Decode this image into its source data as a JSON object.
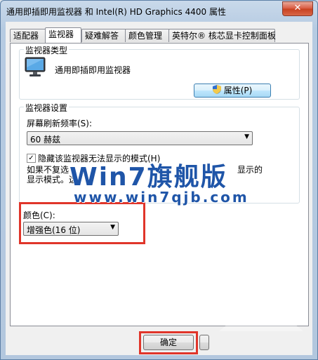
{
  "window": {
    "title": "通用即插即用监视器 和 Intel(R) HD Graphics 4400 属性",
    "close_label": "✕"
  },
  "tabs": [
    {
      "label": "适配器"
    },
    {
      "label": "监视器"
    },
    {
      "label": "疑难解答"
    },
    {
      "label": "颜色管理"
    },
    {
      "label": "英特尔® 核芯显卡控制面板"
    }
  ],
  "monitor_type": {
    "group_title": "监视器类型",
    "name": "通用即插即用监视器",
    "properties_button": "属性(P)"
  },
  "monitor_settings": {
    "group_title": "监视器设置",
    "refresh_label": "屏幕刷新频率(S):",
    "refresh_value": "60 赫兹",
    "hide_modes_label": "隐藏该监视器无法显示的模式(H)",
    "hide_modes_checked": "✓",
    "description_line1": "如果不复选",
    "description_line1_end": "显示的",
    "description_line2": "显示模式。这"
  },
  "color": {
    "label": "颜色(C):",
    "value": "增强色(16 位)"
  },
  "watermark": {
    "big": "Win7旗舰版",
    "url": "www.win7qjb.com"
  },
  "footer": {
    "ok_button": "确定"
  }
}
